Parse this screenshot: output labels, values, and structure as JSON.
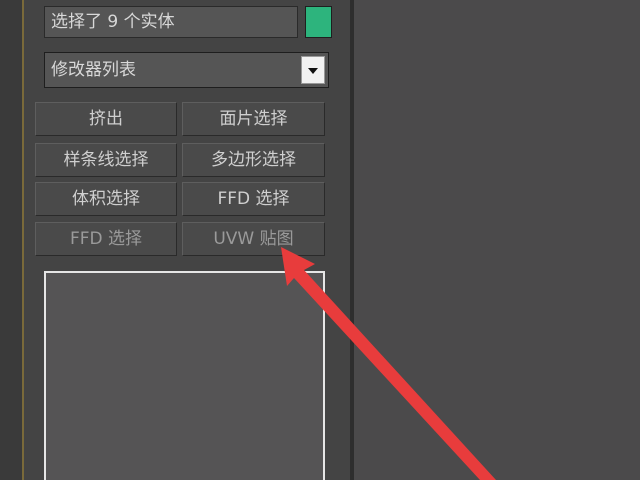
{
  "selection": {
    "status_text": "选择了 9 个实体"
  },
  "colors": {
    "swatch": "#2db47d",
    "annotation_arrow": "#e83c3c"
  },
  "modifier_list": {
    "selected": "修改器列表"
  },
  "modifier_buttons": [
    {
      "label": "挤出"
    },
    {
      "label": "面片选择"
    },
    {
      "label": "样条线选择"
    },
    {
      "label": "多边形选择"
    },
    {
      "label": "体积选择"
    },
    {
      "label": "FFD 选择"
    },
    {
      "label": "FFD 选择"
    },
    {
      "label": "UVW 贴图"
    }
  ]
}
